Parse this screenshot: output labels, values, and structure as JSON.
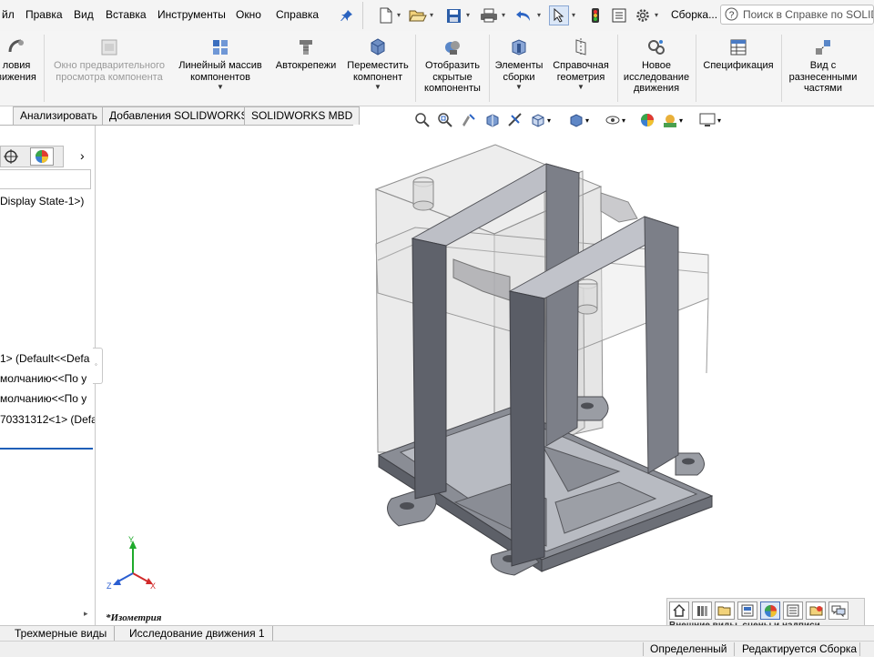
{
  "menu": {
    "items": [
      "йл",
      "Правка",
      "Вид",
      "Вставка",
      "Инструменты",
      "Окно",
      "Справка"
    ],
    "title_dropdown": "Сборка...",
    "search_placeholder": "Поиск в Справке по SOLIDW"
  },
  "commands": [
    {
      "label": "ловия\nвижения",
      "icon": "mate-icon",
      "enabled": true
    },
    {
      "label": "Окно предварительного\nпросмотра компонента",
      "icon": "preview-window-icon",
      "enabled": false
    },
    {
      "label": "Линейный массив\nкомпонентов",
      "icon": "linear-pattern-icon",
      "enabled": true
    },
    {
      "label": "Автокрепежи",
      "icon": "smart-fasteners-icon",
      "enabled": true
    },
    {
      "label": "Переместить\nкомпонент",
      "icon": "move-component-icon",
      "enabled": true
    },
    {
      "label": "Отобразить\nскрытые\nкомпоненты",
      "icon": "show-hidden-icon",
      "enabled": true
    },
    {
      "label": "Элементы\nсборки",
      "icon": "assembly-features-icon",
      "enabled": true
    },
    {
      "label": "Справочная\nгеометрия",
      "icon": "reference-geometry-icon",
      "enabled": true
    },
    {
      "label": "Новое\nисследование\nдвижения",
      "icon": "motion-study-icon",
      "enabled": true
    },
    {
      "label": "Спецификация",
      "icon": "bom-icon",
      "enabled": true
    },
    {
      "label": "Вид с\nразнесенными\nчастями",
      "icon": "exploded-view-icon",
      "enabled": true
    }
  ],
  "tabs": [
    "Анализировать",
    "Добавления SOLIDWORKS",
    "SOLIDWORKS MBD"
  ],
  "tree": {
    "display_state": "Display State-1>)",
    "rows": [
      "1> (Default<<Defa",
      "молчанию<<По у",
      "молчанию<<По у",
      "70331312<1> (Defa"
    ]
  },
  "viewport": {
    "view_name": "*Изометрия",
    "triad": {
      "x": "X",
      "y": "Y",
      "z": "Z"
    }
  },
  "bottom_tabs": [
    "Трехмерные виды",
    "Исследование движения 1"
  ],
  "taskpane_label": "Внешние виды, сцены и надписи",
  "status": {
    "defined": "Определенный",
    "editing": "Редактируется Сборка"
  },
  "colors": {
    "accent": "#1f5fb8",
    "viewport_bg": "#ffffff",
    "part_gray": "#7c7f88"
  }
}
